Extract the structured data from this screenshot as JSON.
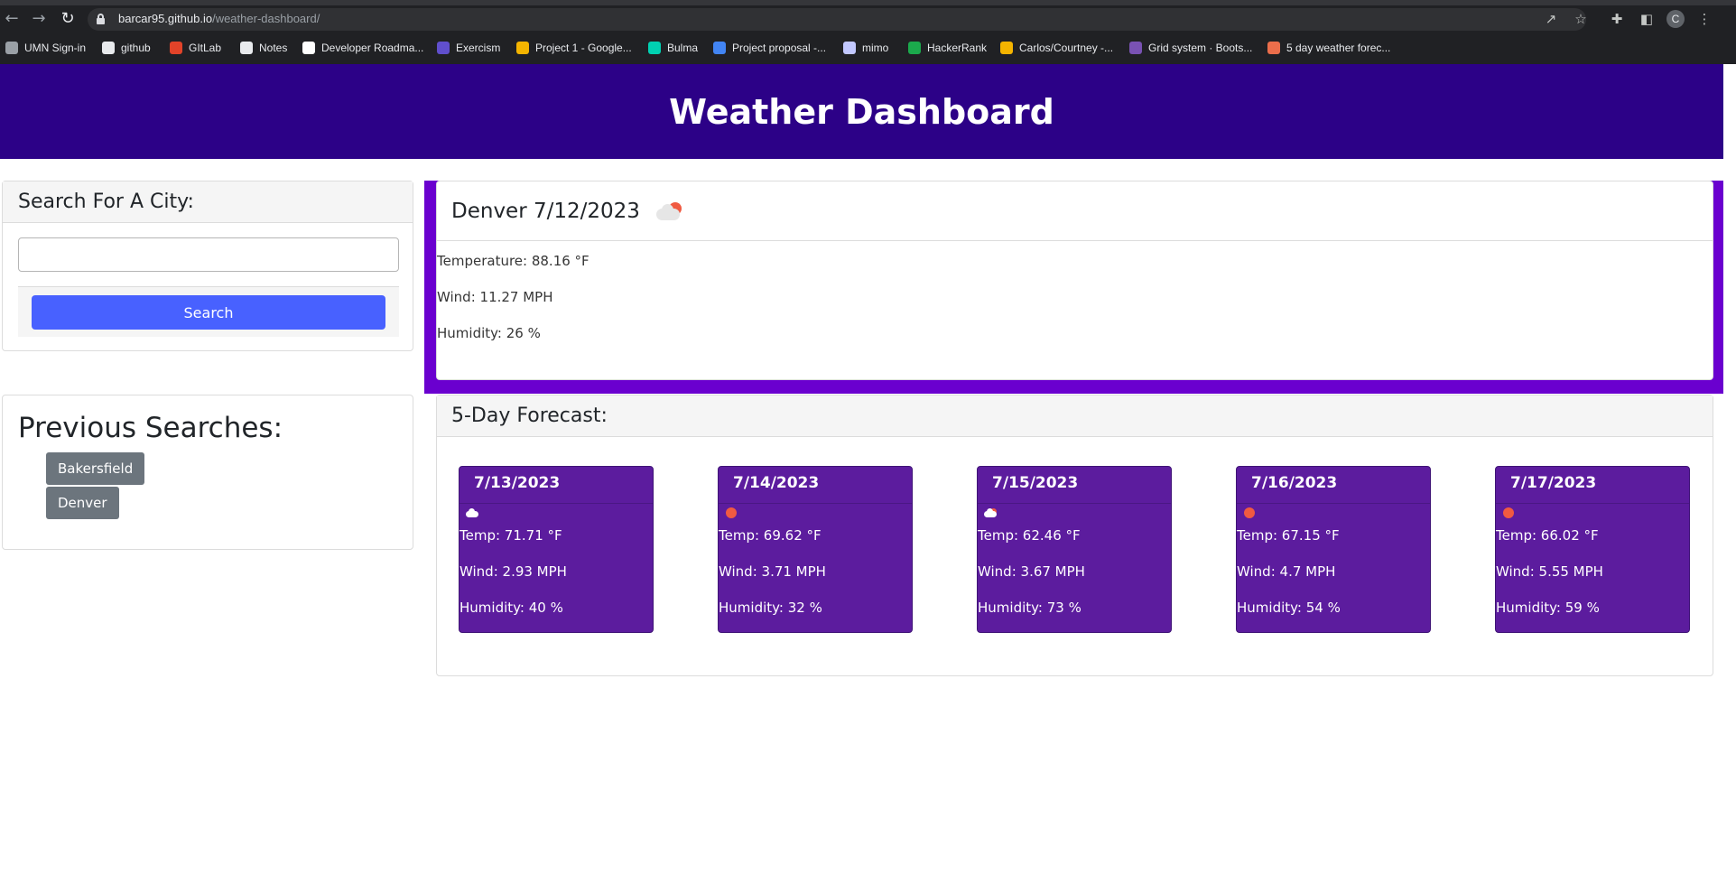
{
  "browser": {
    "url_host": "barcar95.github.io",
    "url_path": "/weather-dashboard/",
    "profile_initial": "C",
    "bookmarks": [
      {
        "label": "UMN Sign-in",
        "color": "#9aa0a6"
      },
      {
        "label": "github",
        "color": "#e8eaed"
      },
      {
        "label": "GItLab",
        "color": "#e24329"
      },
      {
        "label": "Notes",
        "color": "#e8eaed"
      },
      {
        "label": "Developer Roadma...",
        "color": "#ffffff"
      },
      {
        "label": "Exercism",
        "color": "#604fcd"
      },
      {
        "label": "Project 1 - Google...",
        "color": "#f4b400"
      },
      {
        "label": "Bulma",
        "color": "#00d1b2"
      },
      {
        "label": "Project proposal -...",
        "color": "#4285f4"
      },
      {
        "label": "mimo",
        "color": "#c2c8ff"
      },
      {
        "label": "HackerRank",
        "color": "#1ba94c"
      },
      {
        "label": "Carlos/Courtney -...",
        "color": "#f4b400"
      },
      {
        "label": "Grid system · Boots...",
        "color": "#7952b3"
      },
      {
        "label": "5 day weather forec...",
        "color": "#eb6e4b"
      }
    ]
  },
  "header": {
    "title": "Weather Dashboard",
    "background": "#2c0187"
  },
  "search": {
    "heading": "Search For A City:",
    "input_value": "",
    "input_placeholder": "",
    "button_label": "Search",
    "button_color": "#4861ff"
  },
  "history": {
    "heading": "Previous Searches:",
    "items": [
      "Bakersfield",
      "Denver"
    ]
  },
  "current": {
    "title": "Denver 7/12/2023",
    "icon": "cloud-sun-icon",
    "temperature": "Temperature: 88.16 °F",
    "wind": "Wind: 11.27 MPH",
    "humidity": "Humidity: 26 %",
    "accent": "#6a00cf"
  },
  "forecast": {
    "heading": "5-Day Forecast:",
    "card_color": "#5c1c9e",
    "days": [
      {
        "date": "7/13/2023",
        "icon": "cloud-icon",
        "temp": "Temp: 71.71 °F",
        "wind": "Wind: 2.93 MPH",
        "humidity": "Humidity: 40 %"
      },
      {
        "date": "7/14/2023",
        "icon": "sun-icon",
        "temp": "Temp: 69.62 °F",
        "wind": "Wind: 3.71 MPH",
        "humidity": "Humidity: 32 %"
      },
      {
        "date": "7/15/2023",
        "icon": "cloud-sun-icon",
        "temp": "Temp: 62.46 °F",
        "wind": "Wind: 3.67 MPH",
        "humidity": "Humidity: 73 %"
      },
      {
        "date": "7/16/2023",
        "icon": "sun-icon",
        "temp": "Temp: 67.15 °F",
        "wind": "Wind: 4.7 MPH",
        "humidity": "Humidity: 54 %"
      },
      {
        "date": "7/17/2023",
        "icon": "sun-icon",
        "temp": "Temp: 66.02 °F",
        "wind": "Wind: 5.55 MPH",
        "humidity": "Humidity: 59 %"
      }
    ]
  }
}
